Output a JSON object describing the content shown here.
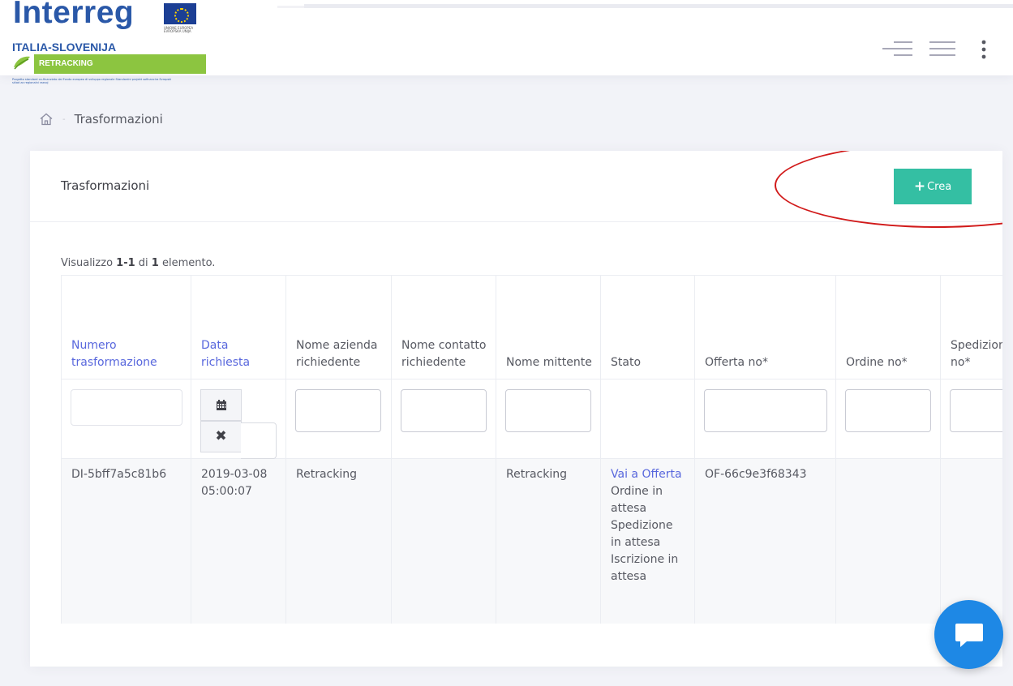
{
  "logo": {
    "brand": "Interreg",
    "eu_text": "UNIONE EUROPEA EVROPSKA UNIJA",
    "region": "ITALIA-SLOVENIJA",
    "project": "RETRACKING",
    "fine_print": "Progetto standard co-finanziato dal Fondo europeo di sviluppo regionale Standardni projekt sofinancira Evropski sklad za regionalni razvoj"
  },
  "header": {
    "icons": [
      "menu-lines-icon",
      "hamburger-icon",
      "more-vertical-icon"
    ]
  },
  "breadcrumb": {
    "home_icon": "home-icon",
    "separator": "-",
    "current": "Trasformazioni"
  },
  "portlet": {
    "title": "Trasformazioni",
    "create_button": {
      "icon": "+",
      "label": "Crea"
    }
  },
  "summary": {
    "prefix": "Visualizzo ",
    "range": "1-1",
    "middle": " di ",
    "total": "1",
    "suffix": " elemento."
  },
  "table": {
    "columns": [
      {
        "label": "Numero trasformazione",
        "sortable": true
      },
      {
        "label": "Data richiesta",
        "sortable": true
      },
      {
        "label": "Nome azienda richiedente",
        "sortable": false
      },
      {
        "label": "Nome contatto richiedente",
        "sortable": false
      },
      {
        "label": "Nome mittente",
        "sortable": false
      },
      {
        "label": "Stato",
        "sortable": false
      },
      {
        "label": "Offerta no*",
        "sortable": false
      },
      {
        "label": "Ordine no*",
        "sortable": false
      },
      {
        "label": "Spedizione no*",
        "sortable": false
      }
    ],
    "rows": [
      {
        "numero": "DI-5bff7a5c81b6",
        "data": "2019-03-08 05:00:07",
        "azienda": "Retracking",
        "contatto": "",
        "mittente": "Retracking",
        "stato_link": "Vai a Offerta",
        "stato_lines": [
          "Ordine in attesa",
          "Spedizione in attesa",
          "Iscrizione in attesa"
        ],
        "offerta": "OF-66c9e3f68343",
        "ordine": "",
        "spedizione": ""
      }
    ]
  },
  "icons": {
    "calendar": "calendar-icon",
    "clear": "✖",
    "chat": "chat-bubble-icon"
  },
  "colors": {
    "accent": "#5867dd",
    "success": "#34bfa3",
    "chat": "#1e88e5",
    "annotation": "#d11a1a"
  }
}
